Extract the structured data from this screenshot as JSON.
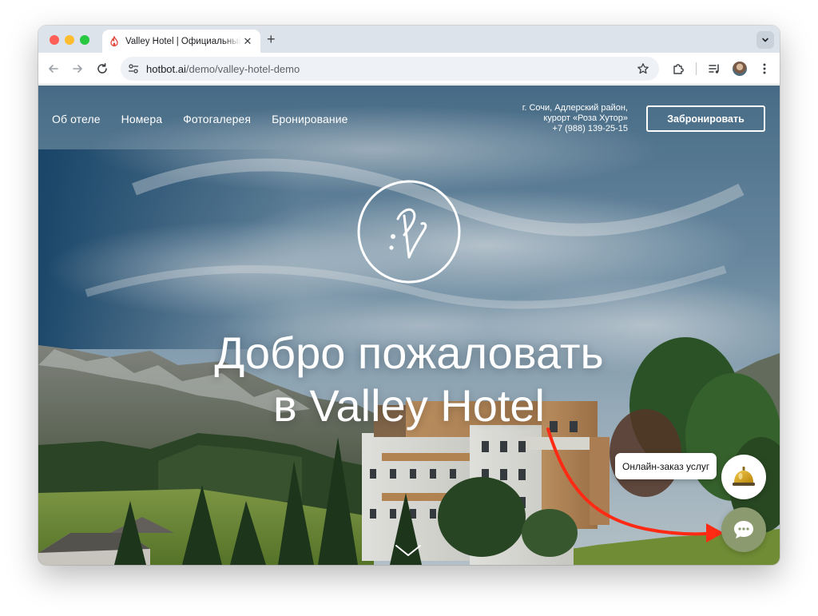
{
  "browser": {
    "tab_title": "Valley Hotel | Официальный сайт",
    "url_host": "hotbot.ai",
    "url_path": "/demo/valley-hotel-demo"
  },
  "nav": {
    "items": [
      {
        "label": "Об отеле"
      },
      {
        "label": "Номера"
      },
      {
        "label": "Фотогалерея"
      },
      {
        "label": "Бронирование"
      }
    ]
  },
  "contact": {
    "address_line1": "г. Сочи, Адлерский район,",
    "address_line2": "курорт «Роза Хутор»",
    "phone": "+7 (988) 139-25-15"
  },
  "book_button_label": "Забронировать",
  "hero": {
    "headline_line1": "Добро пожаловать",
    "headline_line2": "в Valley Hotel"
  },
  "widget": {
    "service_label": "Онлайн-заказ услуг",
    "chat_icon": "chat-bubble-icon",
    "bell_icon": "service-bell-icon"
  },
  "colors": {
    "accent_arrow": "#ff2a14",
    "chat_button": "#8b9a6f"
  }
}
